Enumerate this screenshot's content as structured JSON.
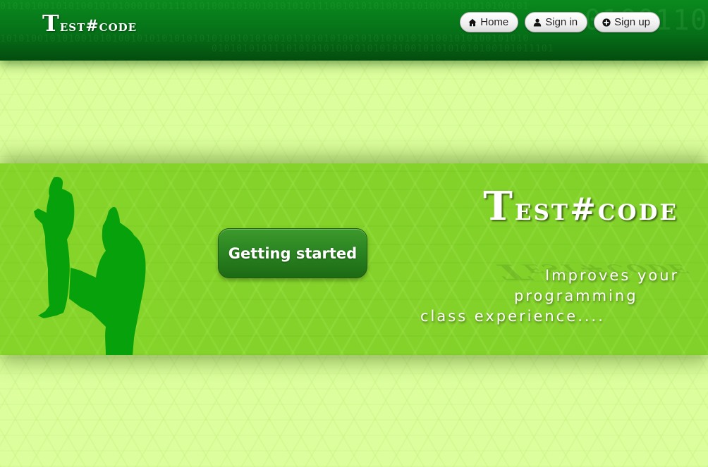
{
  "header": {
    "logo": {
      "first_letter": "T",
      "rest": "est#code"
    },
    "nav": [
      {
        "label": "Home",
        "icon": "home-icon"
      },
      {
        "label": "Sign in",
        "icon": "user-icon"
      },
      {
        "label": "Sign up",
        "icon": "plus-circle-icon"
      }
    ]
  },
  "banner": {
    "cta_label": "Getting started",
    "logo": {
      "first_letter": "T",
      "rest": "est#code"
    },
    "tagline": [
      "Improves your",
      "programming",
      "class experience...."
    ]
  },
  "colors": {
    "header_green": "#067018",
    "page_background": "#dcfe9c",
    "banner_green": "#84d22a",
    "cta_green": "#2b8522",
    "silhouette_green": "#07a10b"
  }
}
